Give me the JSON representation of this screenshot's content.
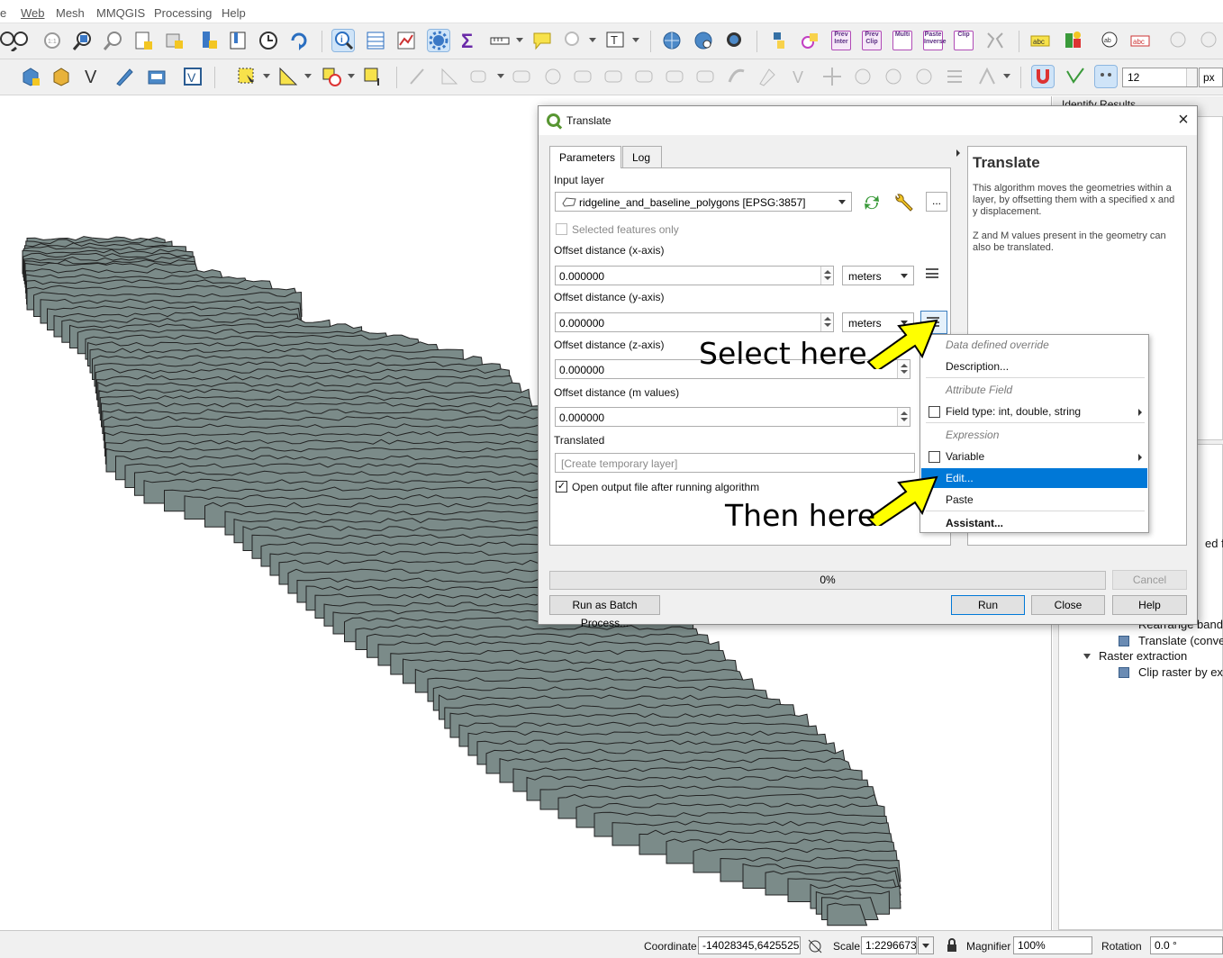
{
  "menu": {
    "items": [
      "e",
      "Web",
      "Mesh",
      "MMQGIS",
      "Processing",
      "Help"
    ]
  },
  "toolbar2": {
    "size_value": "12",
    "size_unit": "px"
  },
  "toolbar1": {
    "prev_inter": "Prev Inter",
    "prev_clip": "Prev Clip",
    "multi": "Multi",
    "paste_inverse": "Paste Inverse",
    "clip": "Clip"
  },
  "right_panel": {
    "title": "Identify Results",
    "partial_text": "ed fe",
    "tree": {
      "rearrange": "Rearrange bands",
      "translate": "Translate (convert",
      "raster_extraction": "Raster extraction",
      "clip_raster": "Clip raster by exte"
    }
  },
  "dialog": {
    "title": "Translate",
    "tabs": [
      "Parameters",
      "Log"
    ],
    "input_layer_label": "Input layer",
    "input_layer_value": "ridgeline_and_baseline_polygons [EPSG:3857]",
    "selected_only": "Selected features only",
    "x_label": "Offset distance (x-axis)",
    "x_value": "0.000000",
    "x_unit": "meters",
    "y_label": "Offset distance (y-axis)",
    "y_value": "0.000000",
    "y_unit": "meters",
    "z_label": "Offset distance (z-axis)",
    "z_value": "0.000000",
    "m_label": "Offset distance (m values)",
    "m_value": "0.000000",
    "translated_label": "Translated",
    "translated_placeholder": "[Create temporary layer]",
    "open_output": "Open output file after running algorithm",
    "progress_text": "0%",
    "progress": 0,
    "buttons": {
      "cancel": "Cancel",
      "batch": "Run as Batch Process...",
      "run": "Run",
      "close": "Close",
      "help": "Help"
    },
    "help": {
      "title": "Translate",
      "p1": "This algorithm moves the geometries within a layer, by offsetting them with a specified x and y displacement.",
      "p2": "Z and M values present in the geometry can also be translated."
    }
  },
  "context_menu": {
    "data_defined_override": "Data defined override",
    "description": "Description...",
    "attribute_field": "Attribute Field",
    "field_type": "Field type: int, double, string",
    "expression": "Expression",
    "variable": "Variable",
    "edit": "Edit...",
    "paste": "Paste",
    "assistant": "Assistant..."
  },
  "annotations": {
    "select_here": "Select here",
    "then_here": "Then here"
  },
  "statusbar": {
    "coordinate_label": "Coordinate",
    "coordinate_value": "-14028345,6425525",
    "scale_label": "Scale",
    "scale_value": "1:2296673",
    "magnifier_label": "Magnifier",
    "magnifier_value": "100%",
    "rotation_label": "Rotation",
    "rotation_value": "0.0 °"
  },
  "colors": {
    "polygon_fill": "#7b8b89",
    "selection_blue": "#0078d7",
    "arrow_yellow": "#ffff00"
  }
}
